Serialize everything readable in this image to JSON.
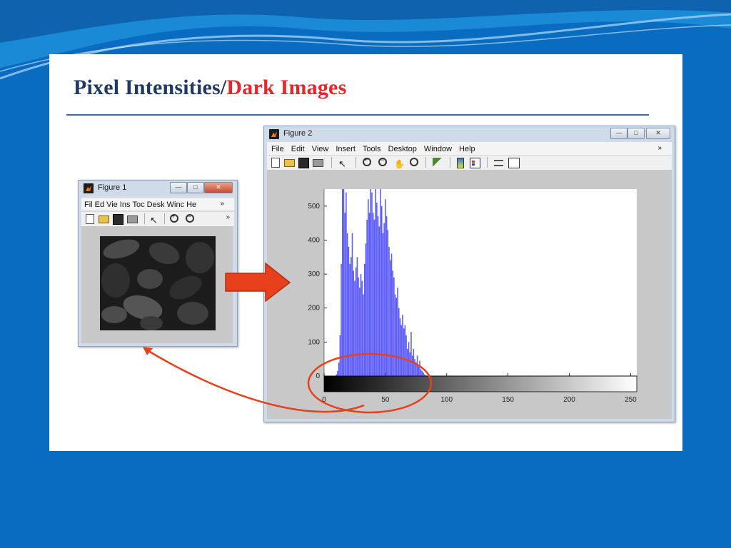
{
  "colors": {
    "slide_background": "#0a6cc0",
    "title_dark": "#1f3864",
    "title_red": "#e8262a",
    "histogram_bars": "#3d3dff",
    "annotation_red": "#e8401c",
    "arrow_red": "#e8401c"
  },
  "slide": {
    "title_part1": "Pixel Intensities/",
    "title_part2": "Dark Images"
  },
  "figure1": {
    "title": "Figure 1",
    "icon": "matlab-icon",
    "menu": [
      "Fil",
      "Ed",
      "Vie",
      "Ins",
      "Toc",
      "Desk",
      "Winc",
      "He"
    ],
    "menu_overflow": "»",
    "toolbar_overflow": "»",
    "image_description": "dark-grayscale-image"
  },
  "figure2": {
    "title": "Figure 2",
    "icon": "matlab-icon",
    "menu": [
      "File",
      "Edit",
      "View",
      "Insert",
      "Tools",
      "Desktop",
      "Window",
      "Help"
    ],
    "menu_overflow": "»",
    "window_controls": [
      "minimize",
      "maximize",
      "close"
    ]
  },
  "chart_data": {
    "type": "bar",
    "title": "",
    "xlabel": "",
    "ylabel": "",
    "xlim": [
      0,
      255
    ],
    "ylim": [
      0,
      550
    ],
    "x_ticks": [
      0,
      50,
      100,
      150,
      200,
      250
    ],
    "y_ticks": [
      0,
      100,
      200,
      300,
      400,
      500
    ],
    "colorbar": "grayscale 0-255 under x-axis",
    "series": [
      {
        "x": [
          10,
          11,
          12,
          13,
          14,
          15,
          16,
          17,
          18,
          19,
          20,
          21,
          22,
          23,
          24,
          25,
          26,
          27,
          28,
          29,
          30,
          31,
          32,
          33,
          34,
          35,
          36,
          37,
          38,
          39,
          40,
          41,
          42,
          43,
          44,
          45,
          46,
          47,
          48,
          49,
          50,
          51,
          52,
          53,
          54,
          55,
          56,
          57,
          58,
          59,
          60,
          61,
          62,
          63,
          64,
          65,
          66,
          67,
          68,
          69,
          70,
          71,
          72,
          73,
          74,
          75,
          76,
          77,
          78,
          79,
          80,
          81,
          82,
          83
        ],
        "values": [
          5,
          15,
          40,
          120,
          330,
          560,
          560,
          480,
          540,
          420,
          380,
          330,
          350,
          420,
          310,
          280,
          320,
          350,
          290,
          260,
          300,
          280,
          240,
          330,
          390,
          460,
          520,
          480,
          560,
          540,
          480,
          460,
          560,
          510,
          470,
          440,
          560,
          500,
          420,
          450,
          520,
          470,
          430,
          380,
          340,
          360,
          310,
          290,
          240,
          230,
          260,
          200,
          170,
          150,
          180,
          140,
          150,
          120,
          80,
          100,
          70,
          130,
          60,
          80,
          50,
          40,
          60,
          30,
          45,
          20,
          15,
          10,
          5,
          2
        ]
      }
    ]
  }
}
